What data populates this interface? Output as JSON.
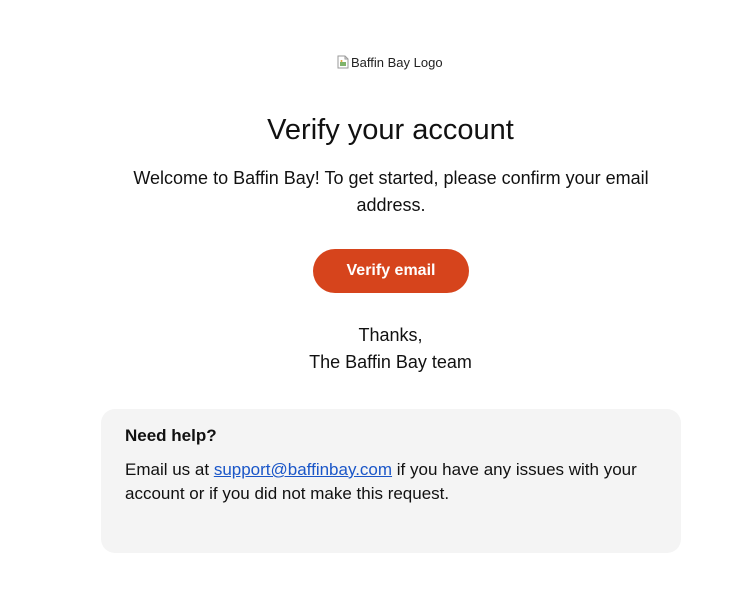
{
  "logo": {
    "alt": "Baffin Bay Logo"
  },
  "header": {
    "title": "Verify your account"
  },
  "intro": {
    "text": "Welcome to Baffin Bay! To get started, please confirm your email address."
  },
  "cta": {
    "label": "Verify email",
    "color": "#d6441c"
  },
  "signoff": {
    "line1": "Thanks,",
    "line2": "The Baffin Bay team"
  },
  "help": {
    "title": "Need help?",
    "prefix": "Email us at ",
    "email": "support@baffinbay.com",
    "suffix": " if you have any issues with your account or if you did not make this request.",
    "link_color": "#1a56c8",
    "background": "#f4f4f4"
  }
}
